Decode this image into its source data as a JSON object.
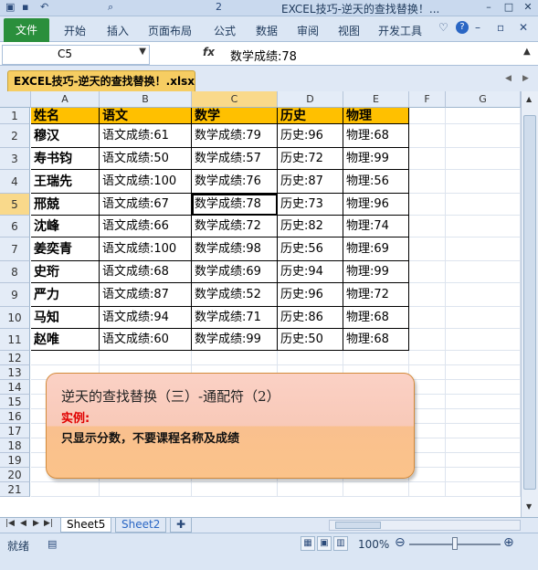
{
  "window": {
    "title": "EXCEL技巧-逆天的查找替换！...",
    "quick_access": [
      "💾",
      "↶",
      "▾",
      "🔍",
      "▦",
      "☰",
      "2",
      "▾"
    ]
  },
  "ribbon": {
    "file_tab": "文件",
    "tabs": [
      "开始",
      "插入",
      "页面布局",
      "公式",
      "数据",
      "审阅",
      "视图",
      "开发工具"
    ]
  },
  "formula_bar": {
    "name_box": "C5",
    "fx": "fx",
    "value": "数学成绩:78"
  },
  "workbook_tab": "EXCEL技巧-逆天的查找替换！.xlsx",
  "columns": [
    "A",
    "B",
    "C",
    "D",
    "E",
    "F",
    "G"
  ],
  "rows": [
    "1",
    "2",
    "3",
    "4",
    "5",
    "6",
    "7",
    "8",
    "9",
    "10",
    "11",
    "12",
    "13",
    "14",
    "15",
    "16",
    "17",
    "18",
    "19",
    "20",
    "21"
  ],
  "table": {
    "headers": [
      "姓名",
      "语文",
      "数学",
      "历史",
      "物理"
    ],
    "records": [
      [
        "穆汉",
        "语文成绩:61",
        "数学成绩:79",
        "历史:96",
        "物理:68"
      ],
      [
        "寿书钧",
        "语文成绩:50",
        "数学成绩:57",
        "历史:72",
        "物理:99"
      ],
      [
        "王瑞先",
        "语文成绩:100",
        "数学成绩:76",
        "历史:87",
        "物理:56"
      ],
      [
        "邢兢",
        "语文成绩:67",
        "数学成绩:78",
        "历史:73",
        "物理:96"
      ],
      [
        "沈峰",
        "语文成绩:66",
        "数学成绩:72",
        "历史:82",
        "物理:74"
      ],
      [
        "姜奕青",
        "语文成绩:100",
        "数学成绩:98",
        "历史:56",
        "物理:69"
      ],
      [
        "史珩",
        "语文成绩:68",
        "数学成绩:69",
        "历史:94",
        "物理:99"
      ],
      [
        "严力",
        "语文成绩:87",
        "数学成绩:52",
        "历史:96",
        "物理:72"
      ],
      [
        "马知",
        "语文成绩:94",
        "数学成绩:71",
        "历史:86",
        "物理:68"
      ],
      [
        "赵唯",
        "语文成绩:60",
        "数学成绩:99",
        "历史:50",
        "物理:68"
      ]
    ]
  },
  "callout": {
    "title": "逆天的查找替换（三）-通配符（2）",
    "label": "实例:",
    "description": "只显示分数，不要课程名称及成绩"
  },
  "sheets": [
    "Sheet5",
    "Sheet2"
  ],
  "status": {
    "ready": "就绪",
    "zoom": "100%"
  },
  "colors": {
    "header_fill": "#ffc000",
    "file_tab": "#2a8f3c",
    "workbook_tab": "#f6cd62",
    "selection_header": "#f9d98b"
  }
}
